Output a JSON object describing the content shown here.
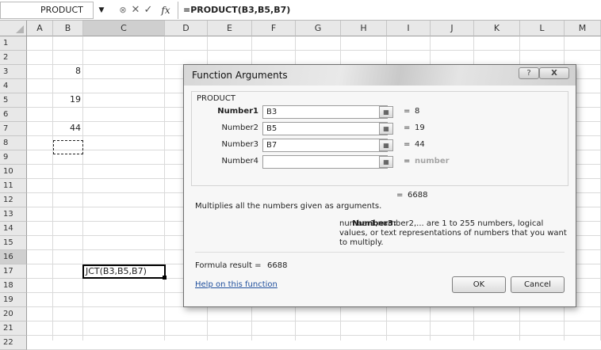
{
  "formula_bar": {
    "name_box": "PRODUCT",
    "dropdown_icon": "▼",
    "cancel_glyph": "⊗",
    "x_glyph": "✕",
    "check_glyph": "✓",
    "fx_label": "fx",
    "formula": "=PRODUCT(B3,B5,B7)"
  },
  "grid": {
    "columns": [
      "A",
      "B",
      "C",
      "D",
      "E",
      "F",
      "G",
      "H",
      "I",
      "J",
      "K",
      "L",
      "M"
    ],
    "rows": [
      "1",
      "2",
      "3",
      "4",
      "5",
      "6",
      "7",
      "8",
      "9",
      "10",
      "11",
      "12",
      "13",
      "14",
      "15",
      "16",
      "17",
      "18",
      "19",
      "20",
      "21",
      "22"
    ],
    "cells": {
      "B3": "8",
      "B5": "19",
      "B7": "44",
      "C16": "JCT(B3,B5,B7)"
    },
    "active_column": "C",
    "active_row": "16"
  },
  "dialog": {
    "title": "Function Arguments",
    "help_glyph": "?",
    "close_glyph": "X",
    "function_name": "PRODUCT",
    "args": [
      {
        "label": "Number1",
        "value": "B3",
        "result": "8",
        "bold": true
      },
      {
        "label": "Number2",
        "value": "B5",
        "result": "19",
        "bold": false
      },
      {
        "label": "Number3",
        "value": "B7",
        "result": "44",
        "bold": false
      },
      {
        "label": "Number4",
        "value": "",
        "result": "number",
        "bold": false
      }
    ],
    "eq": "=",
    "total_result": "6688",
    "description": "Multiplies all the numbers given as arguments.",
    "arg_help_name": "Number3:",
    "arg_help_text": "number1,number2,... are 1 to 255 numbers, logical values, or text representations of numbers that you want to multiply.",
    "formula_result_label": "Formula result =",
    "formula_result_value": "6688",
    "help_link": "Help on this function",
    "ok_label": "OK",
    "cancel_label": "Cancel"
  }
}
